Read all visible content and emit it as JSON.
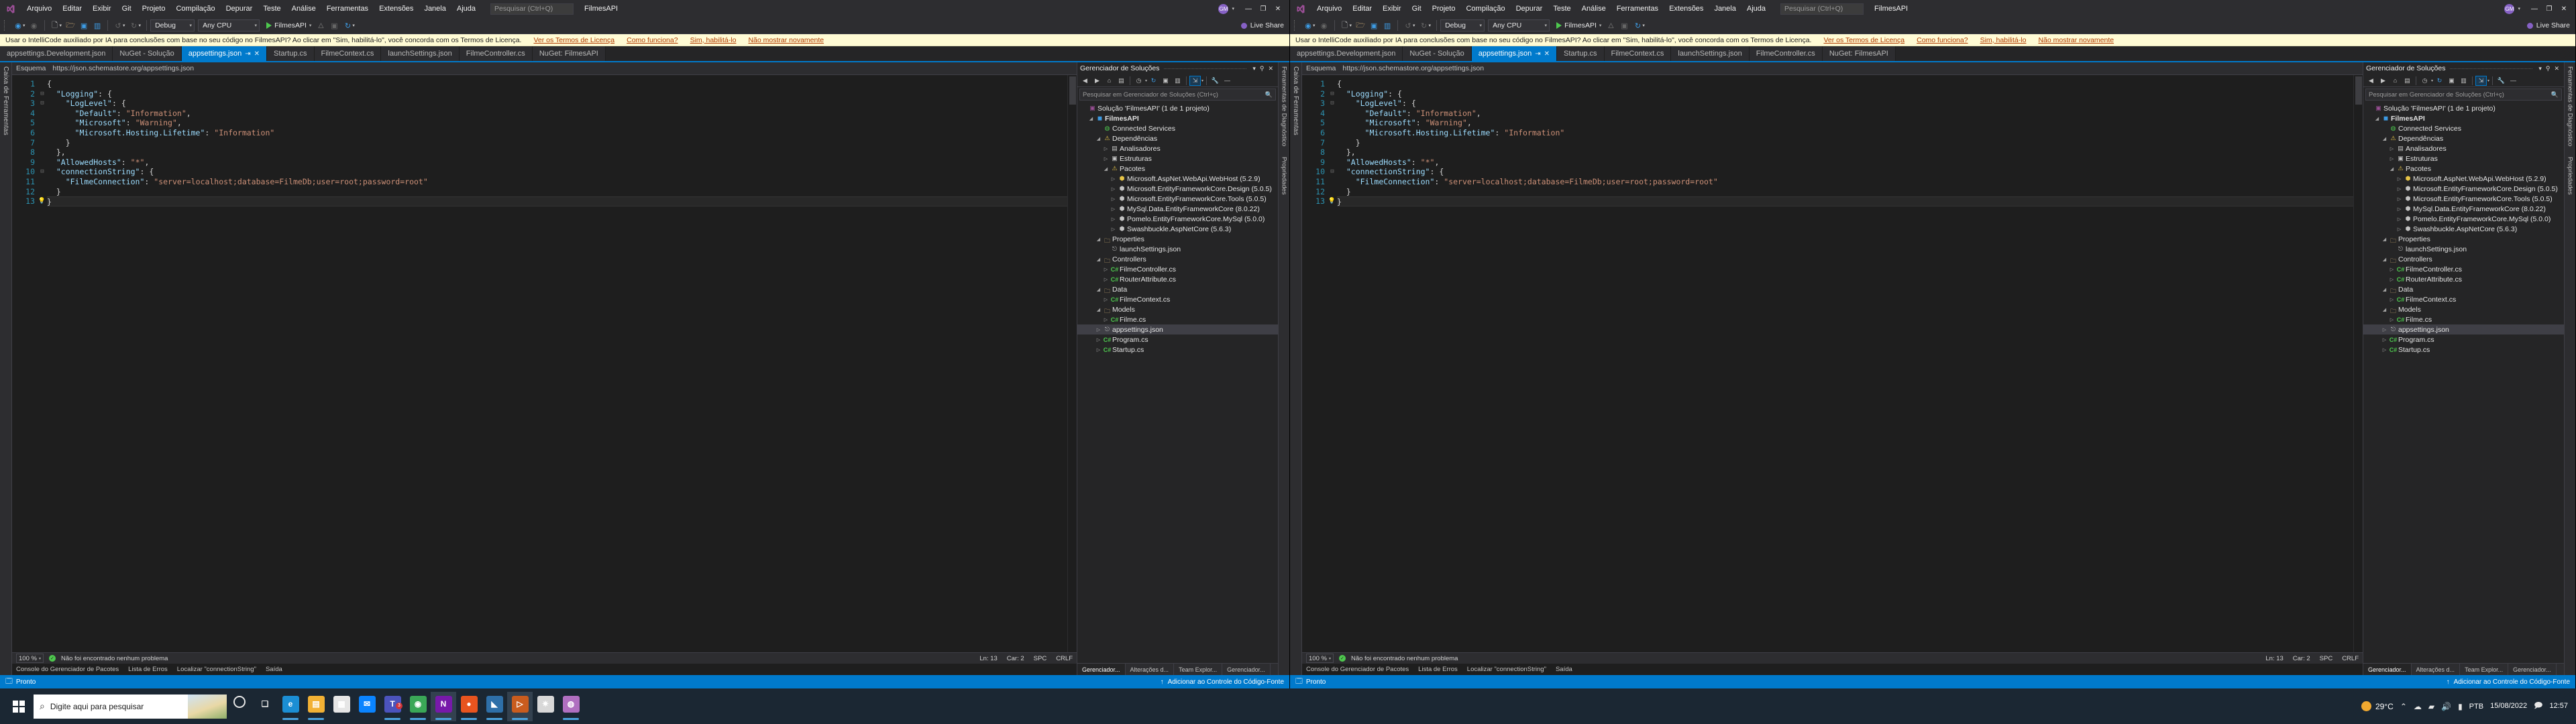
{
  "app": {
    "title": "FilmesAPI",
    "logo_icon": "visual-studio-logo",
    "search_placeholder": "Pesquisar (Ctrl+Q)"
  },
  "menu": {
    "items": [
      {
        "label": "Arquivo"
      },
      {
        "label": "Editar"
      },
      {
        "label": "Exibir"
      },
      {
        "label": "Git"
      },
      {
        "label": "Projeto"
      },
      {
        "label": "Compilação"
      },
      {
        "label": "Depurar"
      },
      {
        "label": "Teste"
      },
      {
        "label": "Análise"
      },
      {
        "label": "Ferramentas"
      },
      {
        "label": "Extensões"
      },
      {
        "label": "Janela"
      },
      {
        "label": "Ajuda"
      }
    ]
  },
  "titlebar_right": {
    "user_initials": "GM",
    "minimize": "—",
    "maximize": "❐",
    "close": "✕"
  },
  "toolbar": {
    "back_icon": "navigate-back-icon",
    "forward_icon": "navigate-forward-icon",
    "new_project_icon": "new-project-icon",
    "open_icon": "open-folder-icon",
    "save_icon": "save-icon",
    "save_all_icon": "save-all-icon",
    "undo_icon": "undo-icon",
    "redo_icon": "redo-icon",
    "config_value": "Debug",
    "platform_value": "Any CPU",
    "run_label": "FilmesAPI",
    "run_icon": "play-icon",
    "hot_reload_icon": "hot-reload-icon",
    "layout_icon": "window-layout-icon",
    "refresh_icon": "refresh-icon",
    "live_share_label": "Live Share",
    "live_share_icon": "live-share-icon"
  },
  "infobar": {
    "message": "Usar o IntelliCode auxiliado por IA para conclusões com base no seu código no FilmesAPI? Ao clicar em \"Sim, habilitá-lo\", você concorda com os Termos de Licença.",
    "links": [
      {
        "label": "Ver os Termos de Licença"
      },
      {
        "label": "Como funciona?"
      },
      {
        "label": "Sim, habilitá-lo"
      },
      {
        "label": "Não mostrar novamente"
      }
    ]
  },
  "tabs": {
    "items": [
      {
        "label": "appsettings.Development.json",
        "active": false
      },
      {
        "label": "NuGet - Solução",
        "active": false
      },
      {
        "label": "appsettings.json",
        "active": true,
        "pin_icon": "pin-icon",
        "close_icon": "close-icon"
      },
      {
        "label": "Startup.cs",
        "active": false
      },
      {
        "label": "FilmeContext.cs",
        "active": false
      },
      {
        "label": "launchSettings.json",
        "active": false
      },
      {
        "label": "FilmeController.cs",
        "active": false
      },
      {
        "label": "NuGet: FilmesAPI",
        "active": false
      }
    ]
  },
  "left_rail": {
    "items": [
      {
        "label": "Caixa de Ferramentas"
      }
    ]
  },
  "right_rail": {
    "items": [
      {
        "label": "Ferramentas de Diagnóstico"
      },
      {
        "label": "Propriedades"
      }
    ]
  },
  "breadcrumb": {
    "label": "Esquema",
    "path": "https://json.schemastore.org/appsettings.json"
  },
  "editor": {
    "lines": [
      {
        "n": 1,
        "fold": "",
        "text": "{"
      },
      {
        "n": 2,
        "fold": "⊟",
        "text": "  \"Logging\": {"
      },
      {
        "n": 3,
        "fold": "⊟",
        "text": "    \"LogLevel\": {"
      },
      {
        "n": 4,
        "fold": "",
        "text": "      \"Default\": \"Information\","
      },
      {
        "n": 5,
        "fold": "",
        "text": "      \"Microsoft\": \"Warning\","
      },
      {
        "n": 6,
        "fold": "",
        "text": "      \"Microsoft.Hosting.Lifetime\": \"Information\""
      },
      {
        "n": 7,
        "fold": "",
        "text": "    }"
      },
      {
        "n": 8,
        "fold": "",
        "text": "  },"
      },
      {
        "n": 9,
        "fold": "",
        "text": "  \"AllowedHosts\": \"*\","
      },
      {
        "n": 10,
        "fold": "⊟",
        "text": "  \"connectionString\": {"
      },
      {
        "n": 11,
        "fold": "",
        "text": "    \"FilmeConnection\": \"server=localhost;database=FilmeDb;user=root;password=root\""
      },
      {
        "n": 12,
        "fold": "",
        "text": "  }"
      },
      {
        "n": 13,
        "fold": "",
        "text": "}",
        "current": true,
        "bulb": true
      }
    ]
  },
  "editor_status": {
    "zoom": "100 %",
    "problems_icon": "check-circle-icon",
    "problems": "Não foi encontrado nenhum problema",
    "line": "Ln: 13",
    "col": "Car: 2",
    "spaces": "SPC",
    "eol": "CRLF"
  },
  "bottom_tabs": {
    "items": [
      {
        "label": "Console do Gerenciador de Pacotes"
      },
      {
        "label": "Lista de Erros"
      },
      {
        "label": "Localizar \"connectionString\""
      },
      {
        "label": "Saída"
      }
    ]
  },
  "solution_explorer": {
    "title": "Gerenciador de Soluções",
    "dropdown_icon": "chevron-down-icon",
    "pin_icon": "pin-icon",
    "close_icon": "close-icon",
    "toolbar_icons": [
      "back-icon",
      "forward-icon",
      "home-icon",
      "switch-views-icon",
      "pending-changes-icon",
      "refresh-icon",
      "collapse-all-icon",
      "show-all-files-icon",
      "properties-icon",
      "preview-selected-icon"
    ],
    "search_placeholder": "Pesquisar em Gerenciador de Soluções (Ctrl+ç)",
    "search_icon": "magnifier-icon",
    "tree": [
      {
        "depth": 0,
        "arrow": "",
        "icon": "solution-icon",
        "icon_class": "sln",
        "label": "Solução 'FilmesAPI' (1 de 1 projeto)",
        "glyph": "▣",
        "bold": false
      },
      {
        "depth": 1,
        "arrow": "◢",
        "icon": "project-icon",
        "icon_class": "proj",
        "label": "FilmesAPI",
        "glyph": "◼",
        "bold": true
      },
      {
        "depth": 2,
        "arrow": "",
        "icon": "connected-services-icon",
        "icon_class": "svc",
        "label": "Connected Services",
        "glyph": "◍",
        "bold": false
      },
      {
        "depth": 2,
        "arrow": "◢",
        "icon": "dependencies-icon",
        "icon_class": "warn",
        "label": "Dependências",
        "glyph": "⚠",
        "bold": false
      },
      {
        "depth": 3,
        "arrow": "▷",
        "icon": "analyzers-icon",
        "icon_class": "dep",
        "label": "Analisadores",
        "glyph": "▤",
        "bold": false
      },
      {
        "depth": 3,
        "arrow": "▷",
        "icon": "frameworks-icon",
        "icon_class": "dep",
        "label": "Estruturas",
        "glyph": "▣",
        "bold": false
      },
      {
        "depth": 3,
        "arrow": "◢",
        "icon": "packages-icon",
        "icon_class": "warn",
        "label": "Pacotes",
        "glyph": "⚠",
        "bold": false
      },
      {
        "depth": 4,
        "arrow": "▷",
        "icon": "package-icon",
        "icon_class": "warn",
        "label": "Microsoft.AspNet.WebApi.WebHost (5.2.9)",
        "glyph": "⬢",
        "bold": false
      },
      {
        "depth": 4,
        "arrow": "▷",
        "icon": "package-icon",
        "icon_class": "pkg",
        "label": "Microsoft.EntityFrameworkCore.Design (5.0.5)",
        "glyph": "⬢",
        "bold": false
      },
      {
        "depth": 4,
        "arrow": "▷",
        "icon": "package-icon",
        "icon_class": "pkg",
        "label": "Microsoft.EntityFrameworkCore.Tools (5.0.5)",
        "glyph": "⬢",
        "bold": false
      },
      {
        "depth": 4,
        "arrow": "▷",
        "icon": "package-icon",
        "icon_class": "pkg",
        "label": "MySql.Data.EntityFrameworkCore (8.0.22)",
        "glyph": "⬢",
        "bold": false
      },
      {
        "depth": 4,
        "arrow": "▷",
        "icon": "package-icon",
        "icon_class": "pkg",
        "label": "Pomelo.EntityFrameworkCore.MySql (5.0.0)",
        "glyph": "⬢",
        "bold": false
      },
      {
        "depth": 4,
        "arrow": "▷",
        "icon": "package-icon",
        "icon_class": "pkg",
        "label": "Swashbuckle.AspNetCore (5.6.3)",
        "glyph": "⬢",
        "bold": false
      },
      {
        "depth": 2,
        "arrow": "◢",
        "icon": "properties-folder-icon",
        "icon_class": "fold",
        "label": "Properties",
        "glyph": "🗀",
        "bold": false
      },
      {
        "depth": 3,
        "arrow": "",
        "icon": "json-file-icon",
        "icon_class": "json",
        "label": "launchSettings.json",
        "glyph": "⎋",
        "bold": false
      },
      {
        "depth": 2,
        "arrow": "◢",
        "icon": "folder-icon",
        "icon_class": "fold",
        "label": "Controllers",
        "glyph": "🗀",
        "bold": false
      },
      {
        "depth": 3,
        "arrow": "▷",
        "icon": "csharp-file-icon",
        "icon_class": "cs",
        "label": "FilmeController.cs",
        "glyph": "C#",
        "bold": false
      },
      {
        "depth": 3,
        "arrow": "▷",
        "icon": "csharp-file-icon",
        "icon_class": "cs",
        "label": "RouterAttribute.cs",
        "glyph": "C#",
        "bold": false
      },
      {
        "depth": 2,
        "arrow": "◢",
        "icon": "folder-icon",
        "icon_class": "fold",
        "label": "Data",
        "glyph": "🗀",
        "bold": false
      },
      {
        "depth": 3,
        "arrow": "▷",
        "icon": "csharp-file-icon",
        "icon_class": "cs",
        "label": "FilmeContext.cs",
        "glyph": "C#",
        "bold": false
      },
      {
        "depth": 2,
        "arrow": "◢",
        "icon": "folder-icon",
        "icon_class": "fold",
        "label": "Models",
        "glyph": "🗀",
        "bold": false
      },
      {
        "depth": 3,
        "arrow": "▷",
        "icon": "csharp-file-icon",
        "icon_class": "cs",
        "label": "Filme.cs",
        "glyph": "C#",
        "bold": false
      },
      {
        "depth": 2,
        "arrow": "▷",
        "icon": "json-file-icon",
        "icon_class": "json",
        "label": "appsettings.json",
        "glyph": "⎋",
        "bold": false,
        "selected": true
      },
      {
        "depth": 2,
        "arrow": "▷",
        "icon": "csharp-file-icon",
        "icon_class": "cs",
        "label": "Program.cs",
        "glyph": "C#",
        "bold": false
      },
      {
        "depth": 2,
        "arrow": "▷",
        "icon": "csharp-file-icon",
        "icon_class": "cs",
        "label": "Startup.cs",
        "glyph": "C#",
        "bold": false
      }
    ],
    "bottom_tabs": [
      {
        "label": "Gerenciador...",
        "active": true
      },
      {
        "label": "Alterações d...",
        "active": false
      },
      {
        "label": "Team Explor...",
        "active": false
      },
      {
        "label": "Gerenciador...",
        "active": false
      }
    ]
  },
  "vs_status": {
    "ready_icon": "ready-icon",
    "ready": "Pronto",
    "source_control_icon": "plus-icon",
    "source_control": "Adicionar ao Controle do Código-Fonte"
  },
  "taskbar": {
    "start_icon": "windows-start-icon",
    "search_placeholder": "Digite aqui para pesquisar",
    "search_icon": "search-icon",
    "cortana_icon": "cortana-icon",
    "taskview_icon": "task-view-icon",
    "apps": [
      {
        "name": "edge-icon",
        "glyph": "e",
        "color": "#1b8ed4",
        "open": true
      },
      {
        "name": "file-explorer-icon",
        "glyph": "▤",
        "color": "#f2b134",
        "open": true
      },
      {
        "name": "microsoft-store-icon",
        "glyph": "▦",
        "color": "#e6e6e6",
        "open": false
      },
      {
        "name": "mail-icon",
        "glyph": "✉",
        "color": "#0a84ff",
        "open": false
      },
      {
        "name": "teams-icon",
        "glyph": "T",
        "color": "#4b53bc",
        "open": true,
        "badge": "3"
      },
      {
        "name": "chrome-icon",
        "glyph": "◉",
        "color": "#3aa757",
        "open": true
      },
      {
        "name": "onenote-icon",
        "glyph": "N",
        "color": "#7719aa",
        "open": true,
        "active": true
      },
      {
        "name": "whatsapp-icon",
        "glyph": "●",
        "color": "#e8541f",
        "open": true
      },
      {
        "name": "vscode-icon",
        "glyph": "◣",
        "color": "#2e6fa8",
        "open": true
      },
      {
        "name": "visual-studio-icon",
        "glyph": "▷",
        "color": "#c95c1e",
        "open": true,
        "active": true
      },
      {
        "name": "settings-icon",
        "glyph": "✷",
        "color": "#d8d8d8",
        "open": false
      },
      {
        "name": "media-player-icon",
        "glyph": "◍",
        "color": "#b06fc0",
        "open": true
      }
    ],
    "weather": {
      "temp": "29°C",
      "icon": "sun-icon"
    },
    "tray_icons": [
      "chevron-up-icon",
      "onedrive-icon",
      "network-icon",
      "volume-icon",
      "battery-icon"
    ],
    "language": "PTB",
    "date": "15/08/2022",
    "time": "12:57",
    "notification_icon": "notifications-icon",
    "right_clock": "12:57"
  }
}
